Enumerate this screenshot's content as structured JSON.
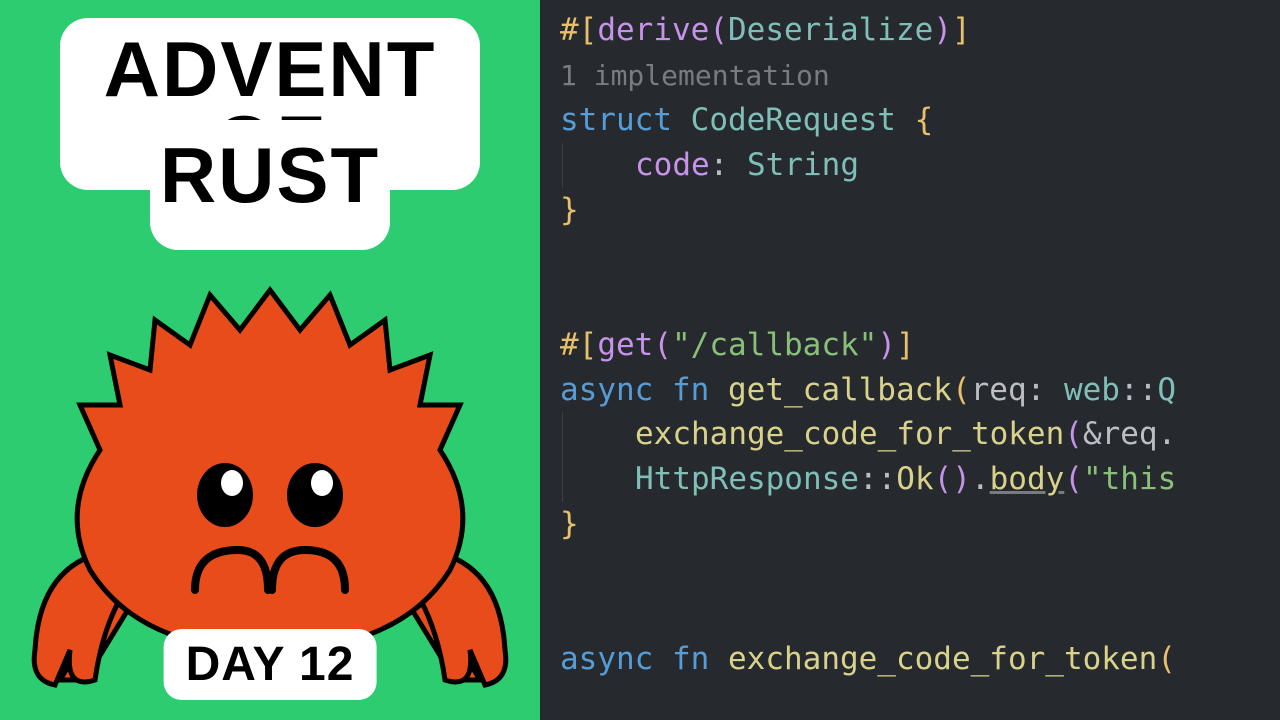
{
  "left": {
    "title_line1": "ADVENT OF",
    "title_line2": "RUST",
    "day_label": "DAY 12"
  },
  "code": {
    "hint": "1 implementation",
    "tokens": {
      "hash": "#",
      "derive": "derive",
      "deserialize": "Deserialize",
      "struct": "struct",
      "code_request": "CodeRequest",
      "brace_open": "{",
      "brace_close": "}",
      "field_code": "code",
      "colon": ":",
      "string_type": "String",
      "get": "get",
      "route": "\"/callback\"",
      "async": "async",
      "fn": "fn",
      "get_callback": "get_callback",
      "req": "req",
      "web": "web",
      "double_colon": "::",
      "exchange_code_for_token": "exchange_code_for_token",
      "amp": "&",
      "req2": "req",
      "http_response": "HttpResponse",
      "ok": "Ok",
      "body": "body",
      "this_str": "\"this",
      "paren_open": "(",
      "paren_close": ")",
      "bracket_open": "[",
      "bracket_close": "]",
      "dot": ".",
      "letter_q": "Q"
    }
  }
}
